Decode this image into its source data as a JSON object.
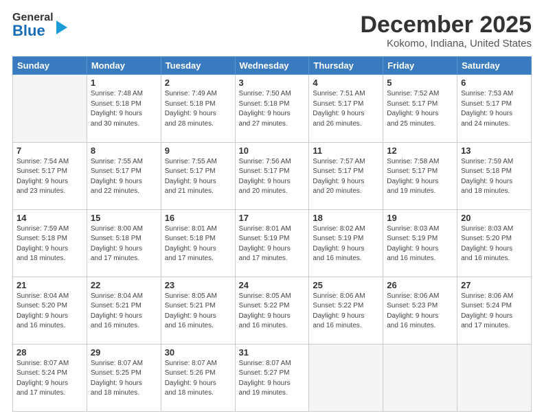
{
  "header": {
    "logo_general": "General",
    "logo_blue": "Blue",
    "title": "December 2025",
    "location": "Kokomo, Indiana, United States"
  },
  "days_of_week": [
    "Sunday",
    "Monday",
    "Tuesday",
    "Wednesday",
    "Thursday",
    "Friday",
    "Saturday"
  ],
  "weeks": [
    [
      {
        "day": "",
        "info": ""
      },
      {
        "day": "1",
        "info": "Sunrise: 7:48 AM\nSunset: 5:18 PM\nDaylight: 9 hours\nand 30 minutes."
      },
      {
        "day": "2",
        "info": "Sunrise: 7:49 AM\nSunset: 5:18 PM\nDaylight: 9 hours\nand 28 minutes."
      },
      {
        "day": "3",
        "info": "Sunrise: 7:50 AM\nSunset: 5:18 PM\nDaylight: 9 hours\nand 27 minutes."
      },
      {
        "day": "4",
        "info": "Sunrise: 7:51 AM\nSunset: 5:17 PM\nDaylight: 9 hours\nand 26 minutes."
      },
      {
        "day": "5",
        "info": "Sunrise: 7:52 AM\nSunset: 5:17 PM\nDaylight: 9 hours\nand 25 minutes."
      },
      {
        "day": "6",
        "info": "Sunrise: 7:53 AM\nSunset: 5:17 PM\nDaylight: 9 hours\nand 24 minutes."
      }
    ],
    [
      {
        "day": "7",
        "info": "Sunrise: 7:54 AM\nSunset: 5:17 PM\nDaylight: 9 hours\nand 23 minutes."
      },
      {
        "day": "8",
        "info": "Sunrise: 7:55 AM\nSunset: 5:17 PM\nDaylight: 9 hours\nand 22 minutes."
      },
      {
        "day": "9",
        "info": "Sunrise: 7:55 AM\nSunset: 5:17 PM\nDaylight: 9 hours\nand 21 minutes."
      },
      {
        "day": "10",
        "info": "Sunrise: 7:56 AM\nSunset: 5:17 PM\nDaylight: 9 hours\nand 20 minutes."
      },
      {
        "day": "11",
        "info": "Sunrise: 7:57 AM\nSunset: 5:17 PM\nDaylight: 9 hours\nand 20 minutes."
      },
      {
        "day": "12",
        "info": "Sunrise: 7:58 AM\nSunset: 5:17 PM\nDaylight: 9 hours\nand 19 minutes."
      },
      {
        "day": "13",
        "info": "Sunrise: 7:59 AM\nSunset: 5:18 PM\nDaylight: 9 hours\nand 18 minutes."
      }
    ],
    [
      {
        "day": "14",
        "info": "Sunrise: 7:59 AM\nSunset: 5:18 PM\nDaylight: 9 hours\nand 18 minutes."
      },
      {
        "day": "15",
        "info": "Sunrise: 8:00 AM\nSunset: 5:18 PM\nDaylight: 9 hours\nand 17 minutes."
      },
      {
        "day": "16",
        "info": "Sunrise: 8:01 AM\nSunset: 5:18 PM\nDaylight: 9 hours\nand 17 minutes."
      },
      {
        "day": "17",
        "info": "Sunrise: 8:01 AM\nSunset: 5:19 PM\nDaylight: 9 hours\nand 17 minutes."
      },
      {
        "day": "18",
        "info": "Sunrise: 8:02 AM\nSunset: 5:19 PM\nDaylight: 9 hours\nand 16 minutes."
      },
      {
        "day": "19",
        "info": "Sunrise: 8:03 AM\nSunset: 5:19 PM\nDaylight: 9 hours\nand 16 minutes."
      },
      {
        "day": "20",
        "info": "Sunrise: 8:03 AM\nSunset: 5:20 PM\nDaylight: 9 hours\nand 16 minutes."
      }
    ],
    [
      {
        "day": "21",
        "info": "Sunrise: 8:04 AM\nSunset: 5:20 PM\nDaylight: 9 hours\nand 16 minutes."
      },
      {
        "day": "22",
        "info": "Sunrise: 8:04 AM\nSunset: 5:21 PM\nDaylight: 9 hours\nand 16 minutes."
      },
      {
        "day": "23",
        "info": "Sunrise: 8:05 AM\nSunset: 5:21 PM\nDaylight: 9 hours\nand 16 minutes."
      },
      {
        "day": "24",
        "info": "Sunrise: 8:05 AM\nSunset: 5:22 PM\nDaylight: 9 hours\nand 16 minutes."
      },
      {
        "day": "25",
        "info": "Sunrise: 8:06 AM\nSunset: 5:22 PM\nDaylight: 9 hours\nand 16 minutes."
      },
      {
        "day": "26",
        "info": "Sunrise: 8:06 AM\nSunset: 5:23 PM\nDaylight: 9 hours\nand 16 minutes."
      },
      {
        "day": "27",
        "info": "Sunrise: 8:06 AM\nSunset: 5:24 PM\nDaylight: 9 hours\nand 17 minutes."
      }
    ],
    [
      {
        "day": "28",
        "info": "Sunrise: 8:07 AM\nSunset: 5:24 PM\nDaylight: 9 hours\nand 17 minutes."
      },
      {
        "day": "29",
        "info": "Sunrise: 8:07 AM\nSunset: 5:25 PM\nDaylight: 9 hours\nand 18 minutes."
      },
      {
        "day": "30",
        "info": "Sunrise: 8:07 AM\nSunset: 5:26 PM\nDaylight: 9 hours\nand 18 minutes."
      },
      {
        "day": "31",
        "info": "Sunrise: 8:07 AM\nSunset: 5:27 PM\nDaylight: 9 hours\nand 19 minutes."
      },
      {
        "day": "",
        "info": ""
      },
      {
        "day": "",
        "info": ""
      },
      {
        "day": "",
        "info": ""
      }
    ]
  ]
}
